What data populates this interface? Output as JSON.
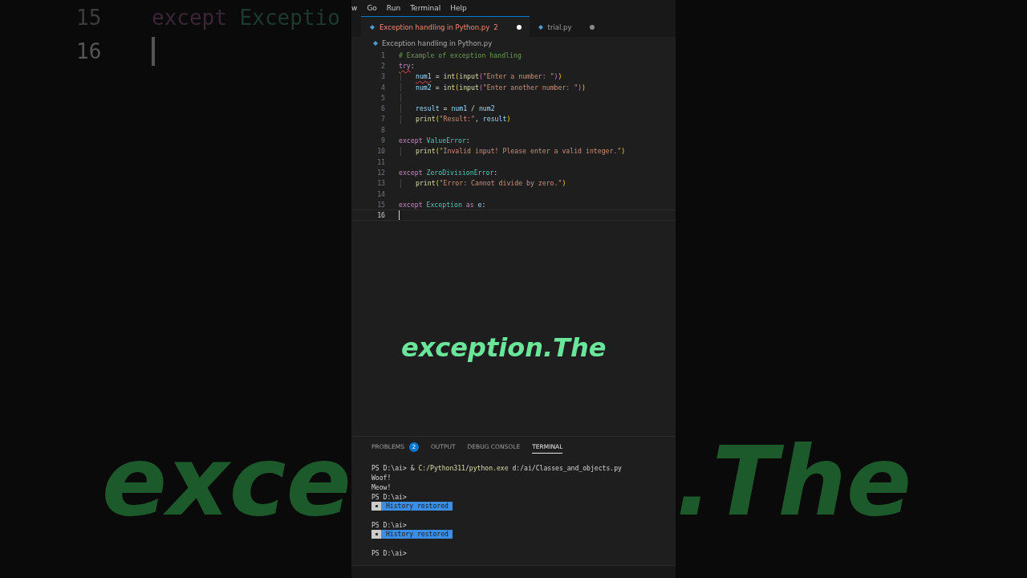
{
  "backdrop": {
    "left_code": [
      {
        "number": "15",
        "tokens": [
          {
            "kind": "keyword",
            "text": "except "
          },
          {
            "kind": "class",
            "text": "Exceptio"
          }
        ]
      },
      {
        "number": "16",
        "current": true
      }
    ],
    "left_caption": "exce",
    "right_caption": ".The"
  },
  "menu_bar": [
    "w",
    "Go",
    "Run",
    "Terminal",
    "Help"
  ],
  "tabs": [
    {
      "label": "Exception handling in Python.py",
      "problems": "2",
      "selected": true,
      "modified": true
    },
    {
      "label": "trial.py",
      "selected": false,
      "modified": true
    }
  ],
  "breadcrumb": "Exception handling in Python.py",
  "code_lines": [
    {
      "number": "1",
      "indented": false,
      "tokens": [
        {
          "kind": "comment",
          "text": "# Example of exception handling"
        }
      ]
    },
    {
      "number": "2",
      "indented": false,
      "tokens": [
        {
          "kind": "keyword",
          "text": "try",
          "squiggle": true
        },
        {
          "kind": "plain",
          "text": ":"
        }
      ]
    },
    {
      "number": "3",
      "indented": true,
      "tokens": [
        {
          "kind": "variable",
          "text": "num1",
          "squiggle": true
        },
        {
          "kind": "plain",
          "text": " = "
        },
        {
          "kind": "function",
          "text": "int"
        },
        {
          "kind": "paren1",
          "text": "("
        },
        {
          "kind": "function",
          "text": "input"
        },
        {
          "kind": "paren2",
          "text": "("
        },
        {
          "kind": "string",
          "text": "\"Enter a number: \""
        },
        {
          "kind": "paren2",
          "text": ")"
        },
        {
          "kind": "paren1",
          "text": ")"
        }
      ]
    },
    {
      "number": "4",
      "indented": true,
      "tokens": [
        {
          "kind": "variable",
          "text": "num2"
        },
        {
          "kind": "plain",
          "text": " = "
        },
        {
          "kind": "function",
          "text": "int"
        },
        {
          "kind": "paren1",
          "text": "("
        },
        {
          "kind": "function",
          "text": "input"
        },
        {
          "kind": "paren2",
          "text": "("
        },
        {
          "kind": "string",
          "text": "\"Enter another number: \""
        },
        {
          "kind": "paren2",
          "text": ")"
        },
        {
          "kind": "paren1",
          "text": ")"
        }
      ]
    },
    {
      "number": "5",
      "indented": true
    },
    {
      "number": "6",
      "indented": true,
      "tokens": [
        {
          "kind": "variable",
          "text": "result"
        },
        {
          "kind": "plain",
          "text": " = "
        },
        {
          "kind": "variable",
          "text": "num1"
        },
        {
          "kind": "plain",
          "text": " / "
        },
        {
          "kind": "variable",
          "text": "num2"
        }
      ]
    },
    {
      "number": "7",
      "indented": true,
      "tokens": [
        {
          "kind": "function",
          "text": "print"
        },
        {
          "kind": "paren1",
          "text": "("
        },
        {
          "kind": "string",
          "text": "\"Result:\""
        },
        {
          "kind": "plain",
          "text": ", "
        },
        {
          "kind": "variable",
          "text": "result"
        },
        {
          "kind": "paren1",
          "text": ")"
        }
      ]
    },
    {
      "number": "8",
      "indented": false
    },
    {
      "number": "9",
      "indented": false,
      "tokens": [
        {
          "kind": "keyword",
          "text": "except "
        },
        {
          "kind": "class",
          "text": "ValueError"
        },
        {
          "kind": "plain",
          "text": ":"
        }
      ]
    },
    {
      "number": "10",
      "indented": true,
      "tokens": [
        {
          "kind": "function",
          "text": "print"
        },
        {
          "kind": "paren1",
          "text": "("
        },
        {
          "kind": "string",
          "text": "\"Invalid input! Please enter a valid integer.\""
        },
        {
          "kind": "paren1",
          "text": ")"
        }
      ]
    },
    {
      "number": "11",
      "indented": false
    },
    {
      "number": "12",
      "indented": false,
      "tokens": [
        {
          "kind": "keyword",
          "text": "except "
        },
        {
          "kind": "class",
          "text": "ZeroDivisionError"
        },
        {
          "kind": "plain",
          "text": ":"
        }
      ]
    },
    {
      "number": "13",
      "indented": true,
      "tokens": [
        {
          "kind": "function",
          "text": "print"
        },
        {
          "kind": "paren1",
          "text": "("
        },
        {
          "kind": "string",
          "text": "\"Error: Cannot divide by zero.\""
        },
        {
          "kind": "paren1",
          "text": ")"
        }
      ]
    },
    {
      "number": "14",
      "indented": false
    },
    {
      "number": "15",
      "indented": false,
      "tokens": [
        {
          "kind": "keyword",
          "text": "except "
        },
        {
          "kind": "class",
          "text": "Exception "
        },
        {
          "kind": "keyword",
          "text": "as "
        },
        {
          "kind": "variable",
          "text": "e"
        },
        {
          "kind": "plain",
          "text": ":"
        }
      ]
    },
    {
      "number": "16",
      "indented": false,
      "current": true
    }
  ],
  "caption": "exception.The",
  "panel_tabs": [
    {
      "label": "PROBLEMS",
      "count": "2",
      "selected": false
    },
    {
      "label": "OUTPUT",
      "selected": false
    },
    {
      "label": "DEBUG CONSOLE",
      "selected": false
    },
    {
      "label": "TERMINAL",
      "selected": true
    }
  ],
  "terminal_lines": [
    {
      "kind": "text",
      "tokens": [
        {
          "kind": "plain",
          "text": "PS D:\\ai> & "
        },
        {
          "kind": "function",
          "text": "C:/Python311/python.exe"
        },
        {
          "kind": "plain",
          "text": " d:/ai/Classes_and_objects.py"
        }
      ]
    },
    {
      "kind": "text",
      "tokens": [
        {
          "kind": "plain",
          "text": "Woof!"
        }
      ]
    },
    {
      "kind": "text",
      "tokens": [
        {
          "kind": "plain",
          "text": "Meow!"
        }
      ]
    },
    {
      "kind": "text",
      "tokens": [
        {
          "kind": "plain",
          "text": "PS D:\\ai>"
        }
      ]
    },
    {
      "kind": "badge",
      "text": "History restored"
    },
    {
      "kind": "blank"
    },
    {
      "kind": "text",
      "tokens": [
        {
          "kind": "plain",
          "text": "PS D:\\ai>"
        }
      ]
    },
    {
      "kind": "badge",
      "text": "History restored"
    },
    {
      "kind": "blank"
    },
    {
      "kind": "text",
      "tokens": [
        {
          "kind": "plain",
          "text": "PS D:\\ai>"
        }
      ]
    }
  ]
}
